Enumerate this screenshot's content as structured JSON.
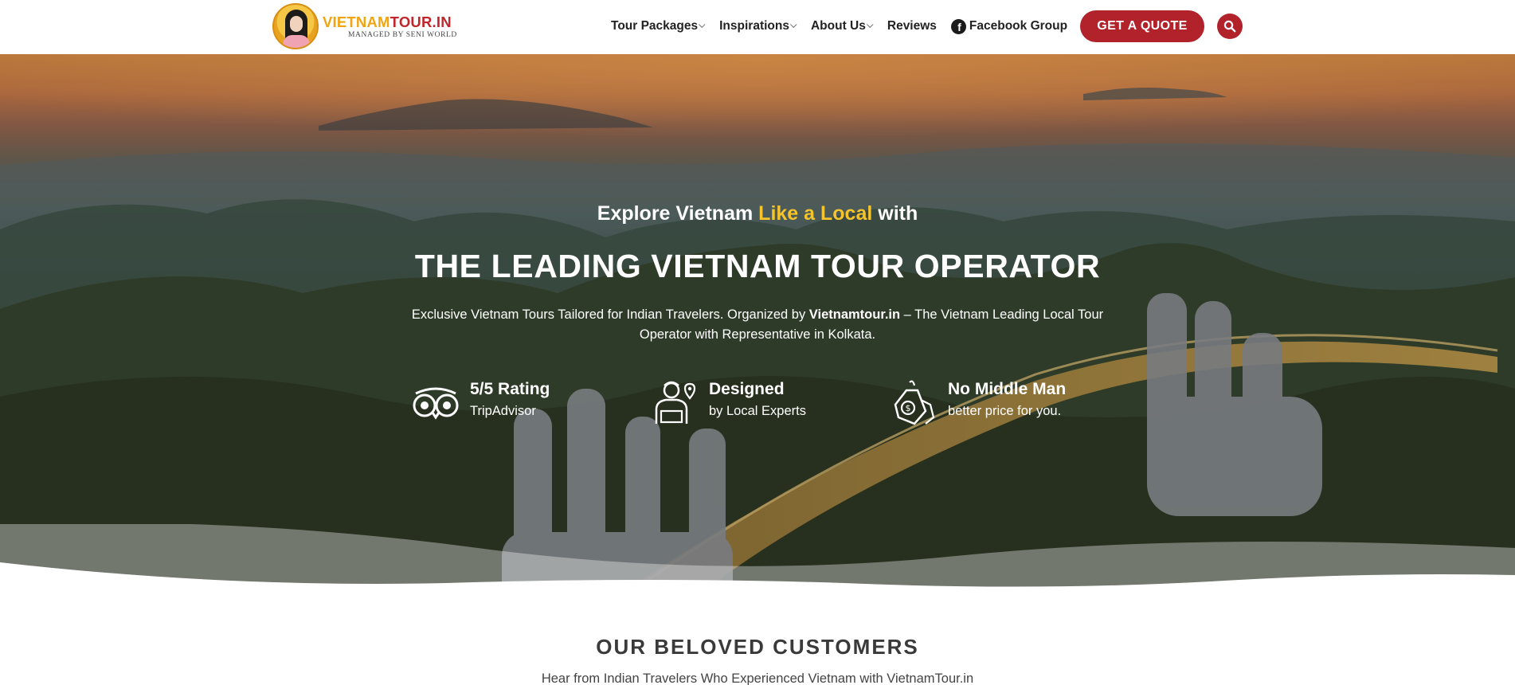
{
  "header": {
    "logo": {
      "part1": "VIETNAM",
      "part2": "TOUR.IN",
      "tagline": "MANAGED BY SENI WORLD"
    },
    "nav": [
      {
        "label": "Tour Packages",
        "dropdown": true
      },
      {
        "label": "Inspirations",
        "dropdown": true
      },
      {
        "label": "About Us",
        "dropdown": true
      },
      {
        "label": "Reviews",
        "dropdown": false
      },
      {
        "label": "Facebook Group",
        "icon": "facebook-icon"
      }
    ],
    "cta_label": "GET A QUOTE",
    "search_icon": "search-icon",
    "colors": {
      "accent": "#b1222a",
      "logo_yellow": "#f0a411",
      "logo_red": "#c0262b"
    }
  },
  "hero": {
    "subtitle_pre": "Explore Vietnam ",
    "subtitle_highlight": "Like a Local",
    "subtitle_post": " with",
    "title": "THE LEADING VIETNAM TOUR OPERATOR",
    "desc_pre": "Exclusive Vietnam Tours Tailored for Indian Travelers. Organized by ",
    "desc_bold": "Vietnamtour.in",
    "desc_post": " – The Vietnam Leading Local Tour Operator with Representative in Kolkata.",
    "highlight_color": "#f5c32c",
    "features": [
      {
        "icon": "tripadvisor-owl-icon",
        "title": "5/5 Rating",
        "subtitle": "TripAdvisor"
      },
      {
        "icon": "local-expert-icon",
        "title": "Designed",
        "subtitle": "by Local Experts"
      },
      {
        "icon": "price-tag-icon",
        "title": "No Middle Man",
        "subtitle": "better price for you."
      }
    ]
  },
  "customers": {
    "title": "OUR BELOVED CUSTOMERS",
    "subtitle": "Hear from Indian Travelers Who Experienced Vietnam with VietnamTour.in"
  }
}
